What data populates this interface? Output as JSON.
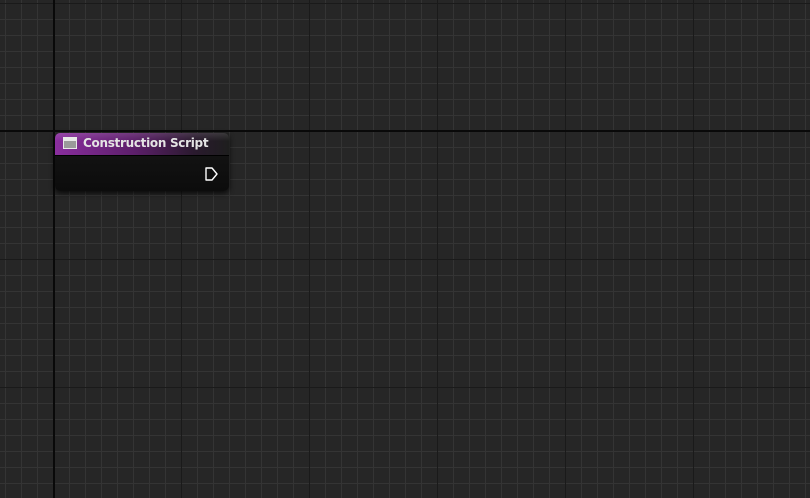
{
  "graph": {
    "background_color": "#262626",
    "minor_grid_color": "#343434",
    "major_grid_color": "#1a1a1a",
    "origin_line_color": "#090909"
  },
  "node": {
    "title": "Construction Script",
    "header_color": "#8a2e9e",
    "header_icon": "function-icon",
    "output_pin": {
      "type": "exec",
      "icon": "exec-output-pin-icon",
      "color": "#ffffff",
      "connected": false
    }
  }
}
